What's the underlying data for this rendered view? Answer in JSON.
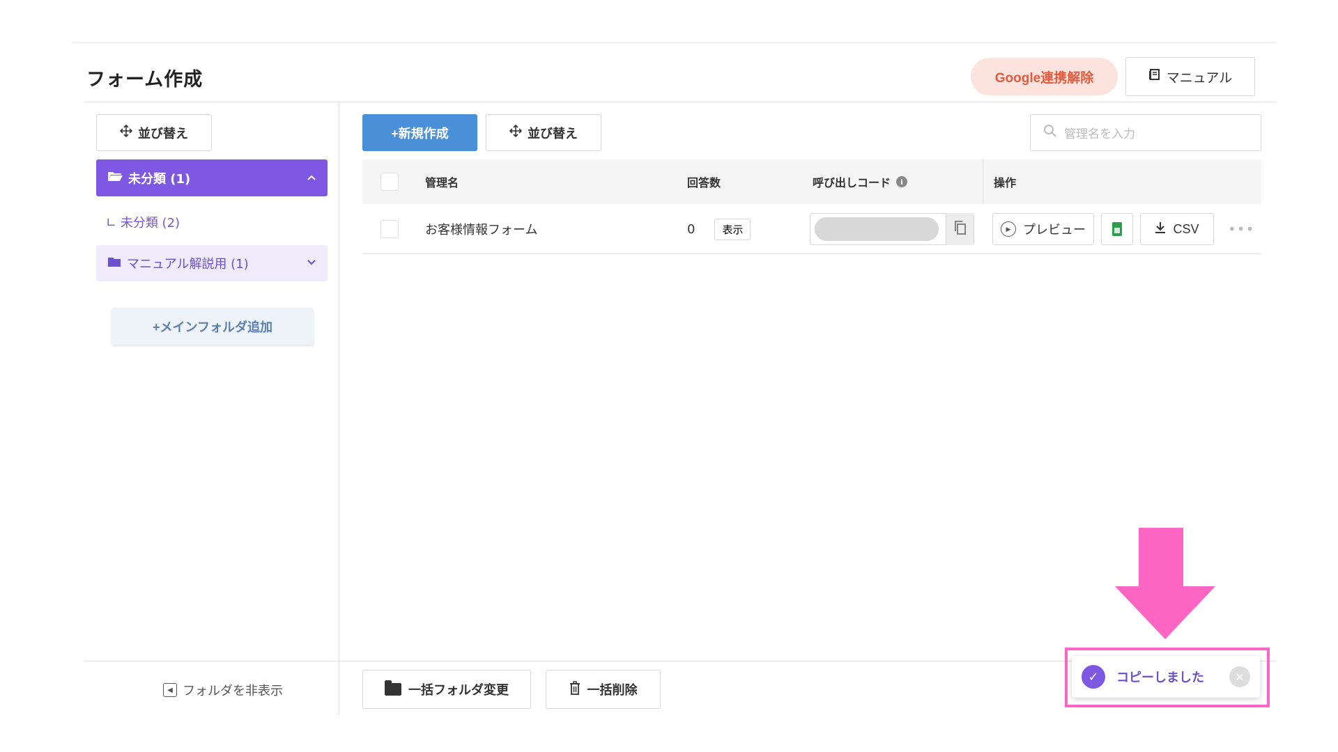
{
  "page": {
    "title": "フォーム作成"
  },
  "header": {
    "google_button": "Google連携解除",
    "manual_button": "マニュアル"
  },
  "sidebar": {
    "sort_button": "並び替え",
    "folders": [
      {
        "label": "未分類 (1)",
        "state": "expanded",
        "active": true
      },
      {
        "label": "未分類 (2)",
        "prefix": "∟",
        "sub": true
      },
      {
        "label": "マニュアル解説用 (1)",
        "state": "collapsed"
      }
    ],
    "add_folder_button": "+メインフォルダ追加",
    "hide_folder_button": "フォルダを非表示"
  },
  "toolbar": {
    "new_button": "+新規作成",
    "sort_button": "並び替え",
    "search_placeholder": "管理名を入力"
  },
  "table": {
    "headers": {
      "name": "管理名",
      "responses": "回答数",
      "code": "呼び出しコード",
      "operations": "操作"
    },
    "rows": [
      {
        "name": "お客様情報フォーム",
        "responses": "0",
        "show_button": "表示",
        "preview_button": "プレビュー",
        "csv_button": "CSV"
      }
    ]
  },
  "footer": {
    "bulk_folder_button": "一括フォルダ変更",
    "bulk_delete_button": "一括削除"
  },
  "toast": {
    "message": "コピーしました"
  },
  "colors": {
    "accent_purple": "#7e57e2",
    "new_button_blue": "#4a90d9",
    "google_button_bg": "#fde3de",
    "google_button_text": "#e25b3e",
    "annotation_pink": "#ff66c4"
  }
}
